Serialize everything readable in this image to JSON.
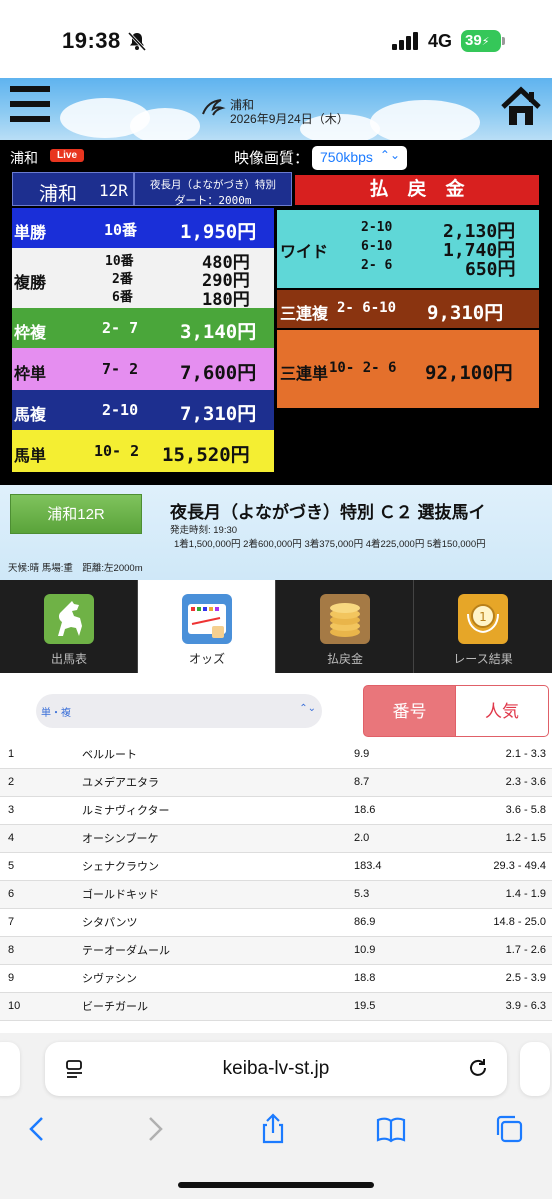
{
  "status_bar": {
    "time": "19:38",
    "network": "4G",
    "battery": "39"
  },
  "header": {
    "venue": "浦和",
    "date": "2026年9月24日（木）"
  },
  "video": {
    "venue": "浦和",
    "live_badge": "Live",
    "quality_label": "映像画質：",
    "quality_value": "750kbps"
  },
  "board": {
    "venue": "浦和",
    "race": "12R",
    "race_name": "夜長月（よながづき）特別",
    "course": "ダート：2000m",
    "payout_header": "払　戻　金",
    "rows": {
      "win": {
        "label": "単勝",
        "numbers": [
          "10番"
        ],
        "amounts": [
          "1,950円"
        ],
        "color": "#1a2fd8"
      },
      "place": {
        "label": "複勝",
        "numbers": [
          "10番",
          "2番",
          "6番"
        ],
        "amounts": [
          "480円",
          "290円",
          "180円"
        ],
        "color": "#f2f2f2"
      },
      "bracket_quinella": {
        "label": "枠複",
        "numbers": [
          "2- 7"
        ],
        "amounts": [
          "3,140円"
        ],
        "color": "#4aa63a"
      },
      "bracket_exacta": {
        "label": "枠単",
        "numbers": [
          "7- 2"
        ],
        "amounts": [
          "7,600円"
        ],
        "color": "#e58ef0"
      },
      "quinella": {
        "label": "馬複",
        "numbers": [
          "2-10"
        ],
        "amounts": [
          "7,310円"
        ],
        "color": "#1d2f8f"
      },
      "exacta": {
        "label": "馬単",
        "numbers": [
          "10- 2"
        ],
        "amounts": [
          "15,520円"
        ],
        "color": "#f4ee32"
      },
      "wide": {
        "label": "ワイド",
        "numbers": [
          "2-10",
          "6-10",
          "2- 6"
        ],
        "amounts": [
          "2,130円",
          "1,740円",
          "650円"
        ],
        "color": "#5fd7d7"
      },
      "trio": {
        "label": "三連複",
        "numbers": [
          "2- 6-10"
        ],
        "amounts": [
          "9,310円"
        ],
        "color": "#8a3410"
      },
      "trifecta": {
        "label": "三連単",
        "numbers": [
          "10- 2- 6"
        ],
        "amounts": [
          "92,100円"
        ],
        "color": "#e4702c"
      }
    }
  },
  "race_info": {
    "button": "浦和12R",
    "title": "夜長月（よながづき）特別 Ｃ２ 選抜馬イ",
    "start_time": "発走時刻: 19:30",
    "prizes": "1着1,500,000円 2着600,000円 3着375,000円 4着225,000円 5着150,000円",
    "conditions": "天候:晴 馬場:重　距離:左2000m"
  },
  "tabs": [
    {
      "label": "出馬表",
      "icon": "horse-icon"
    },
    {
      "label": "オッズ",
      "icon": "odds-board-icon"
    },
    {
      "label": "払戻金",
      "icon": "coins-icon"
    },
    {
      "label": "レース結果",
      "icon": "medal-icon"
    }
  ],
  "odds": {
    "bet_type": "単・複",
    "sort_number": "番号",
    "sort_popularity": "人気",
    "rows": [
      {
        "no": "1",
        "name": "ベルルート",
        "win": "9.9",
        "place": "2.1 - 3.3"
      },
      {
        "no": "2",
        "name": "ユメデアエタラ",
        "win": "8.7",
        "place": "2.3 - 3.6"
      },
      {
        "no": "3",
        "name": "ルミナヴィクター",
        "win": "18.6",
        "place": "3.6 - 5.8"
      },
      {
        "no": "4",
        "name": "オーシンブーケ",
        "win": "2.0",
        "place": "1.2 - 1.5"
      },
      {
        "no": "5",
        "name": "シェナクラウン",
        "win": "183.4",
        "place": "29.3 - 49.4"
      },
      {
        "no": "6",
        "name": "ゴールドキッド",
        "win": "5.3",
        "place": "1.4 - 1.9"
      },
      {
        "no": "7",
        "name": "シタパンツ",
        "win": "86.9",
        "place": "14.8 - 25.0"
      },
      {
        "no": "8",
        "name": "テーオーダムール",
        "win": "10.9",
        "place": "1.7 - 2.6"
      },
      {
        "no": "9",
        "name": "シヴァシン",
        "win": "18.8",
        "place": "2.5 - 3.9"
      },
      {
        "no": "10",
        "name": "ビーチガール",
        "win": "19.5",
        "place": "3.9 - 6.3"
      }
    ]
  },
  "browser": {
    "url": "keiba-lv-st.jp"
  }
}
